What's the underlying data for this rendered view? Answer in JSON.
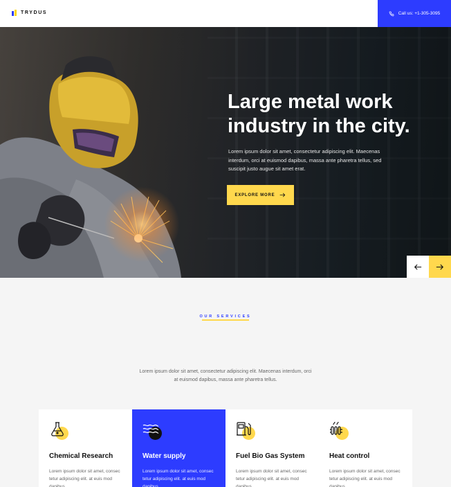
{
  "header": {
    "logo_text": "TRYDUS",
    "call_label": "Call us: +1-305-3095"
  },
  "hero": {
    "title_line1": "Large metal work",
    "title_line2": "industry in the city.",
    "description": "Lorem ipsum dolor sit amet, consectetur adipiscing elit. Maecenas interdum, orci at euismod dapibus, massa ante pharetra tellus, sed suscipit justo augue sit amet erat.",
    "button_label": "EXPLORE MORE"
  },
  "services": {
    "label": "OUR SERVICES",
    "description": "Lorem ipsum dolor sit amet, consectetur adipiscing elit. Maecenas interdum, orci at euismod dapibus, massa ante pharetra tellus.",
    "cards": [
      {
        "title": "Chemical Research",
        "text": "Lorem ipsum dolor sit amet, consec tetur adipiscing elit. at euis mod dapibus,",
        "icon": "flask-icon"
      },
      {
        "title": "Water supply",
        "text": "Lorem ipsum dolor sit amet, consec tetur adipiscing elit. at euis mod dapibus,",
        "icon": "water-waves-icon"
      },
      {
        "title": "Fuel Bio Gas System",
        "text": "Lorem ipsum dolor sit amet, consec tetur adipiscing elit. at euis mod dapibus,",
        "icon": "fuel-pump-icon"
      },
      {
        "title": "Heat control",
        "text": "Lorem ipsum dolor sit amet, consec tetur adipiscing elit. at euis mod dapibus,",
        "icon": "heater-icon"
      }
    ]
  },
  "colors": {
    "accent_blue": "#2d3cff",
    "accent_yellow": "#ffd84d"
  }
}
